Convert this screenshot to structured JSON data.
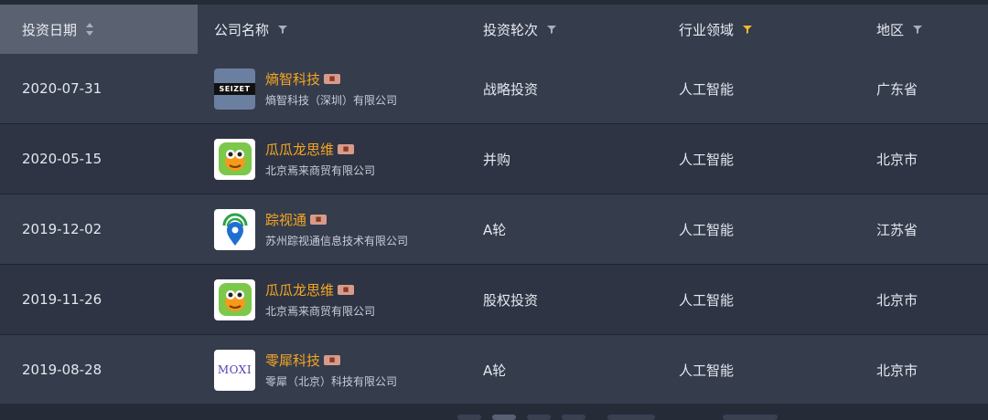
{
  "header": {
    "columns": [
      {
        "label": "投资日期",
        "icon": "sort-icon"
      },
      {
        "label": "公司名称",
        "icon": "filter-icon"
      },
      {
        "label": "投资轮次",
        "icon": "filter-icon"
      },
      {
        "label": "行业领域",
        "icon": "filter-icon-active"
      },
      {
        "label": "地区",
        "icon": "filter-icon"
      }
    ]
  },
  "colors": {
    "header_bg": "#353c4c",
    "active_header_bg": "#5a6170",
    "company_name": "#f5a623",
    "filter_active": "#f5b92a",
    "filter_default": "#a8aebb"
  },
  "rows": [
    {
      "date": "2020-07-31",
      "company": "熵智科技",
      "legal": "熵智科技（深圳）有限公司",
      "round": "战略投资",
      "industry": "人工智能",
      "region": "广东省",
      "logo_text": "SEIZET"
    },
    {
      "date": "2020-05-15",
      "company": "瓜瓜龙思维",
      "legal": "北京焉来商贸有限公司",
      "round": "并购",
      "industry": "人工智能",
      "region": "北京市",
      "logo_text": ""
    },
    {
      "date": "2019-12-02",
      "company": "踪视通",
      "legal": "苏州踪视通信息技术有限公司",
      "round": "A轮",
      "industry": "人工智能",
      "region": "江苏省",
      "logo_text": ""
    },
    {
      "date": "2019-11-26",
      "company": "瓜瓜龙思维",
      "legal": "北京焉来商贸有限公司",
      "round": "股权投资",
      "industry": "人工智能",
      "region": "北京市",
      "logo_text": ""
    },
    {
      "date": "2019-08-28",
      "company": "零犀科技",
      "legal": "零犀（北京）科技有限公司",
      "round": "A轮",
      "industry": "人工智能",
      "region": "北京市",
      "logo_text": "MOXI"
    }
  ]
}
